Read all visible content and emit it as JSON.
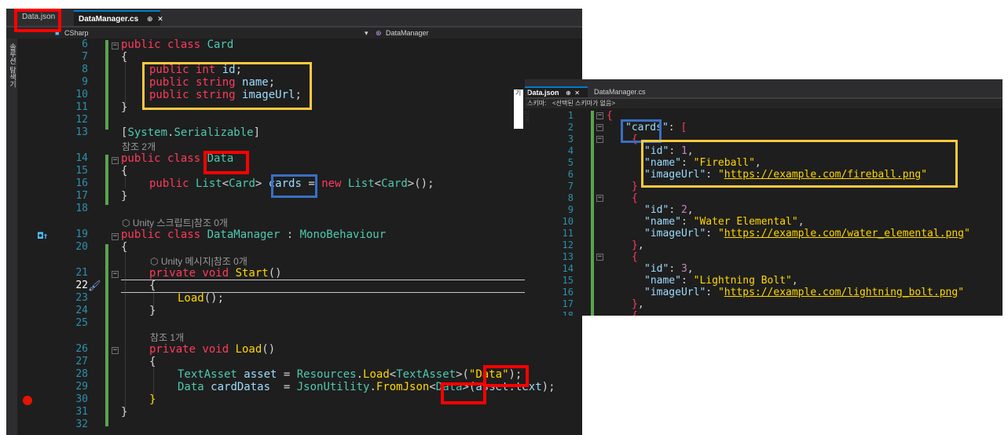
{
  "left_editor": {
    "tabs": [
      {
        "label": "Data.json",
        "active": false
      },
      {
        "label": "DataManager.cs",
        "active": true,
        "pin": "⊕",
        "close": "✕"
      }
    ],
    "nav": {
      "project": "CSharp",
      "member": "DataManager"
    },
    "side_label": "솔루션 탐색기",
    "line_numbers": [
      "6",
      "7",
      "8",
      "9",
      "10",
      "11",
      "12",
      "13",
      "14",
      "15",
      "16",
      "17",
      "18",
      "19",
      "20",
      "21",
      "22",
      "23",
      "24",
      "25",
      "26",
      "27",
      "28",
      "29",
      "30",
      "31",
      "32"
    ],
    "hints": {
      "ref2": "참조 2개",
      "unity_script": "Unity 스크립트|참조 0개",
      "unity_msg": "Unity 메시지|참조 0개",
      "ref1": "참조 1개"
    }
  },
  "right_editor": {
    "tabs": [
      {
        "label": "Data.json",
        "active": true,
        "pin": "⊕",
        "close": "✕"
      },
      {
        "label": "DataManager.cs",
        "active": false
      }
    ],
    "schema_label": "스키마:",
    "schema_value": "<선택된 스키마가 없음>",
    "side_label": "솔루션 탐색기",
    "line_numbers": [
      "1",
      "2",
      "3",
      "4",
      "5",
      "6",
      "7",
      "8",
      "9",
      "10",
      "11",
      "12",
      "13",
      "14",
      "15",
      "16",
      "17",
      "18"
    ],
    "cards": [
      {
        "id": "1",
        "name": "Fireball",
        "imageUrl": "https://example.com/fireball.png"
      },
      {
        "id": "2",
        "name": "Water Elemental",
        "imageUrl": "https://example.com/water_elemental.png"
      },
      {
        "id": "3",
        "name": "Lightning Bolt",
        "imageUrl": "https://example.com/lightning_bolt.png"
      }
    ]
  },
  "colors": {
    "highlight_red": "#ff0000",
    "highlight_yellow": "#ffc940",
    "highlight_blue": "#3a6fc4",
    "editor_bg": "#1e1e1e"
  }
}
